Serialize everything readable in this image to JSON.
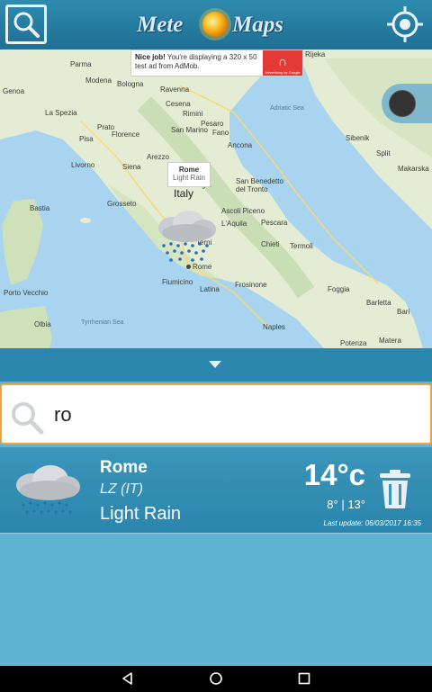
{
  "app": {
    "logo_left": "Mete",
    "logo_right": "Maps"
  },
  "ad": {
    "bold": "Nice job!",
    "text": " You're displaying a 320 x 50 test ad from AdMob.",
    "brand": "Advertising by Google"
  },
  "map": {
    "country": "Italy",
    "callout_city": "Rome",
    "callout_condition": "Light Rain",
    "places": [
      "Parma",
      "Modena",
      "Bologna",
      "Ravenna",
      "Genoa",
      "La Spezia",
      "Cesena",
      "Rimini",
      "San Marino",
      "Pisa",
      "Florence",
      "Arezzo",
      "Livorno",
      "Siena",
      "Perugia",
      "Ancona",
      "Grosseto",
      "San Benedetto del Tronto",
      "Ascoli Piceno",
      "Pescara",
      "Chieti",
      "Termoli",
      "Terni",
      "Rome",
      "Fiumicino",
      "Latina",
      "Frosinone",
      "Foggia",
      "Bastia",
      "Porto Vecchio",
      "Olbia",
      "Naples",
      "Potenza",
      "Matera",
      "Bari",
      "Split",
      "Sibenik",
      "Makarska",
      "Rijeka",
      "Barletta",
      "L'Aquila",
      "Pesaro",
      "Prato",
      "Fano"
    ],
    "sea_labels": [
      "Adriatic Sea",
      "Tyrrhenian Sea"
    ]
  },
  "search": {
    "value": "ro",
    "placeholder": ""
  },
  "result": {
    "city": "Rome",
    "region": "LZ (IT)",
    "condition": "Light Rain",
    "temperature": "14°c",
    "min_max": "8° | 13°",
    "last_update": "Last update: 06/03/2017 16:35"
  },
  "colors": {
    "accent": "#2a86ad",
    "search_border": "#f0a33a",
    "background": "#5fb4d3"
  }
}
